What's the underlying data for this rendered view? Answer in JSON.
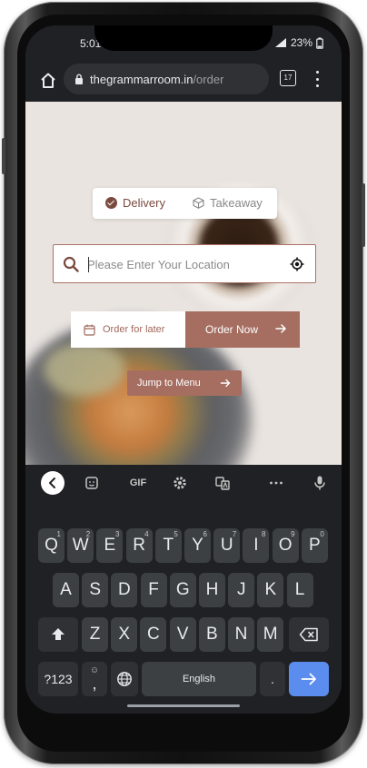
{
  "status": {
    "time": "5:01",
    "battery": "23%"
  },
  "browser": {
    "host": "thegrammarroom.in",
    "path": "/order",
    "tab_count": "17"
  },
  "order": {
    "delivery_label": "Delivery",
    "takeaway_label": "Takeaway",
    "selected_mode": "Delivery",
    "search_placeholder": "Please Enter Your Location",
    "search_value": "",
    "later_label": "Order for later",
    "now_label": "Order Now",
    "jump_label": "Jump to Menu"
  },
  "keyboard": {
    "toolbar": {
      "gif_label": "GIF"
    },
    "row1": [
      {
        "label": "Q",
        "hint": "1"
      },
      {
        "label": "W",
        "hint": "2"
      },
      {
        "label": "E",
        "hint": "3"
      },
      {
        "label": "R",
        "hint": "4"
      },
      {
        "label": "T",
        "hint": "5"
      },
      {
        "label": "Y",
        "hint": "6"
      },
      {
        "label": "U",
        "hint": "7"
      },
      {
        "label": "I",
        "hint": "8"
      },
      {
        "label": "O",
        "hint": "9"
      },
      {
        "label": "P",
        "hint": "0"
      }
    ],
    "row2": [
      "A",
      "S",
      "D",
      "F",
      "G",
      "H",
      "J",
      "K",
      "L"
    ],
    "row3": [
      "Z",
      "X",
      "C",
      "V",
      "B",
      "N",
      "M"
    ],
    "row4": {
      "symbols_label": "?123",
      "comma_label": ",",
      "emoji_hint": "☺",
      "space_label": "English",
      "period_label": "."
    }
  },
  "colors": {
    "accent": "#a66e61",
    "accent_dark": "#7a4a3e",
    "enter_key": "#5b8def"
  }
}
